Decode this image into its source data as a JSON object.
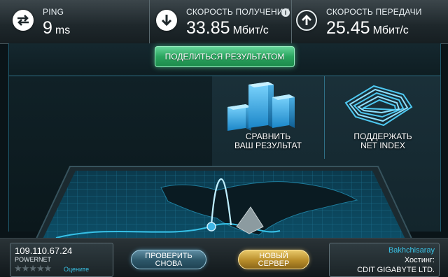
{
  "ping": {
    "label": "PING",
    "value": "9",
    "unit": "ms"
  },
  "download": {
    "label": "СКОРОСТЬ ПОЛУЧЕНИЯ",
    "value": "33.85",
    "unit": "Мбит/с",
    "info": "i"
  },
  "upload": {
    "label": "СКОРОСТЬ ПЕРЕДАЧИ",
    "value": "25.45",
    "unit": "Мбит/с"
  },
  "share": {
    "label": "ПОДЕЛИТЬСЯ РЕЗУЛЬТАТОМ"
  },
  "tiles": {
    "compare": {
      "line1": "СРАВНИТЬ",
      "line2": "ВАШ РЕЗУЛЬТАТ"
    },
    "support": {
      "line1": "ПОДДЕРЖАТЬ",
      "line2": "NET INDEX"
    }
  },
  "client": {
    "ip": "109.110.67.24",
    "isp": "POWERNET",
    "stars": "★★★★★",
    "rate_label": "Оцените"
  },
  "buttons": {
    "retest": {
      "line1": "ПРОВЕРИТЬ",
      "line2": "СНОВА"
    },
    "new_server": {
      "line1": "НОВЫЙ",
      "line2": "СЕРВЕР"
    }
  },
  "server": {
    "city": "Bakhchisaray",
    "host_label": "Хостинг:",
    "host_name": "CDIT GIGABYTE LTD."
  },
  "colors": {
    "accent_cyan": "#39c2e5",
    "share_green": "#2aa55f",
    "server_gold": "#b88d2a",
    "retest_blue": "#2d5769"
  },
  "icons": {
    "ping": "swap-arrows-icon",
    "download": "down-arrow-icon",
    "upload": "up-arrow-icon"
  }
}
